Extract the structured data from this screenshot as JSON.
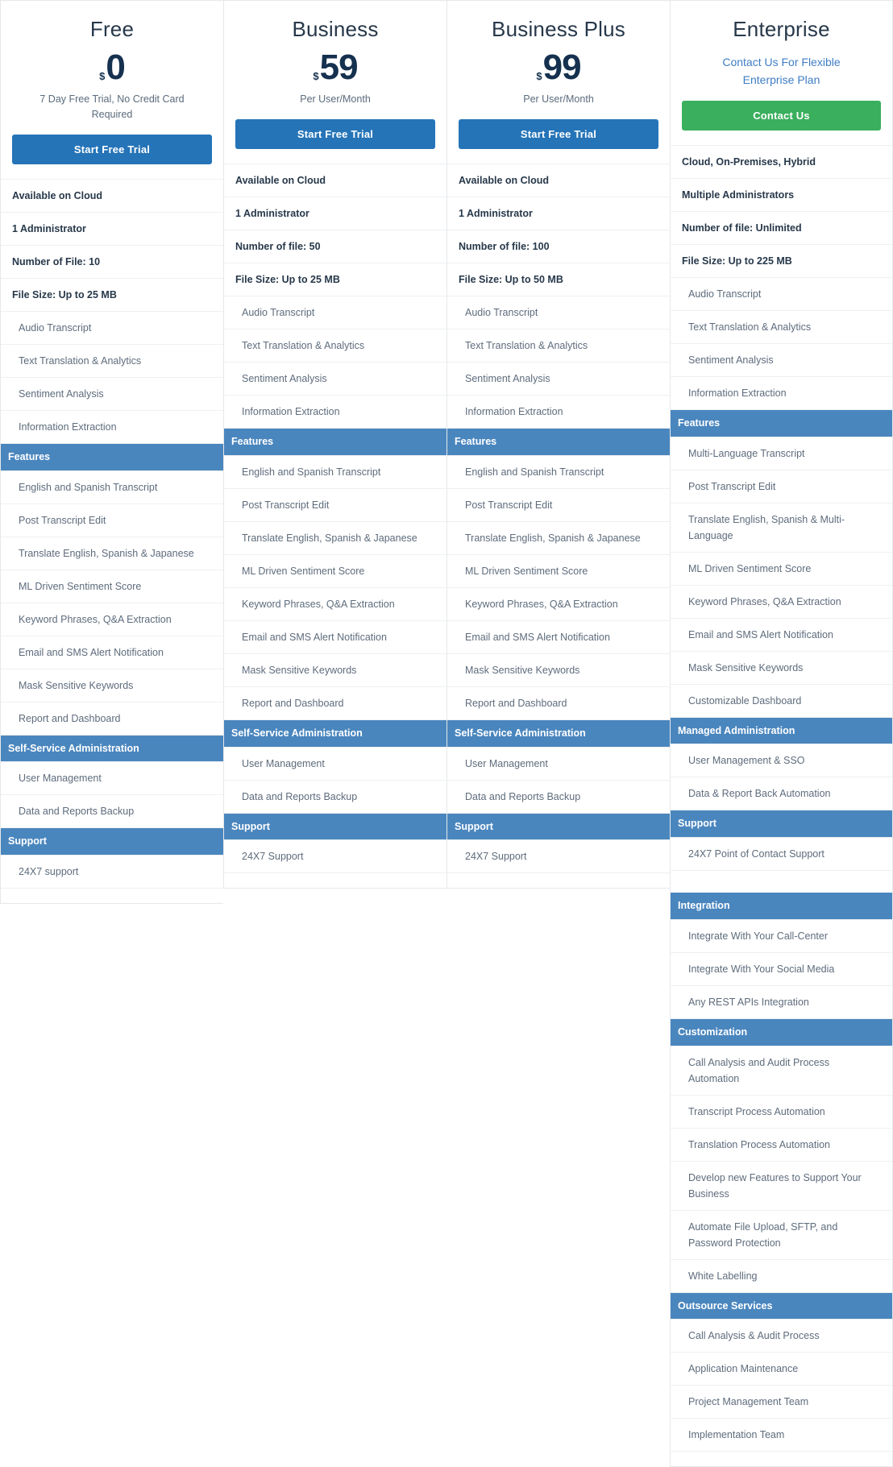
{
  "colors": {
    "accent_blue": "#2574b8",
    "section_header_blue": "#4a86be",
    "cta_green": "#3aaf5d",
    "price_navy": "#15314f",
    "link_blue": "#3f7dc4",
    "body_text": "#5e6c7c"
  },
  "plans": [
    {
      "name": "Free",
      "currency": "$",
      "amount": "0",
      "subtitle": "7 Day Free Trial, No Credit Card Required",
      "cta_label": "Start Free Trial",
      "cta_style": "blue",
      "specs": [
        "Available on Cloud",
        "1 Administrator",
        "Number of File: 10",
        "File Size: Up to 25 MB"
      ],
      "capabilities": [
        "Audio Transcript",
        "Text Translation & Analytics",
        "Sentiment Analysis",
        "Information Extraction"
      ],
      "sections": [
        {
          "title": "Features",
          "items": [
            "English and Spanish Transcript",
            "Post Transcript Edit",
            "Translate English, Spanish & Japanese",
            "ML Driven Sentiment Score",
            "Keyword Phrases, Q&A Extraction",
            "Email and SMS Alert Notification",
            "Mask Sensitive Keywords",
            "Report and Dashboard"
          ]
        },
        {
          "title": "Self-Service Administration",
          "items": [
            "User Management",
            "Data and Reports Backup"
          ]
        },
        {
          "title": "Support",
          "items": [
            "24X7 support"
          ]
        }
      ]
    },
    {
      "name": "Business",
      "currency": "$",
      "amount": "59",
      "subtitle": "Per User/Month",
      "cta_label": "Start Free Trial",
      "cta_style": "blue",
      "specs": [
        "Available on Cloud",
        "1 Administrator",
        "Number of file: 50",
        "File Size: Up to 25 MB"
      ],
      "capabilities": [
        "Audio Transcript",
        "Text Translation & Analytics",
        "Sentiment Analysis",
        "Information Extraction"
      ],
      "sections": [
        {
          "title": "Features",
          "items": [
            "English and Spanish Transcript",
            "Post Transcript Edit",
            "Translate English, Spanish & Japanese",
            "ML Driven Sentiment Score",
            "Keyword Phrases, Q&A Extraction",
            "Email and SMS Alert Notification",
            "Mask Sensitive Keywords",
            "Report and Dashboard"
          ]
        },
        {
          "title": "Self-Service Administration",
          "items": [
            "User Management",
            "Data and Reports Backup"
          ]
        },
        {
          "title": "Support",
          "items": [
            "24X7 Support"
          ]
        }
      ]
    },
    {
      "name": "Business Plus",
      "currency": "$",
      "amount": "99",
      "subtitle": "Per User/Month",
      "cta_label": "Start Free Trial",
      "cta_style": "blue",
      "specs": [
        "Available on Cloud",
        "1 Administrator",
        "Number of file: 100",
        "File Size: Up to 50 MB"
      ],
      "capabilities": [
        "Audio Transcript",
        "Text Translation & Analytics",
        "Sentiment Analysis",
        "Information Extraction"
      ],
      "sections": [
        {
          "title": "Features",
          "items": [
            "English and Spanish Transcript",
            "Post Transcript Edit",
            "Translate English, Spanish & Japanese",
            "ML Driven Sentiment Score",
            "Keyword Phrases, Q&A Extraction",
            "Email and SMS Alert Notification",
            "Mask Sensitive Keywords",
            "Report and Dashboard"
          ]
        },
        {
          "title": "Self-Service Administration",
          "items": [
            "User Management",
            "Data and Reports Backup"
          ]
        },
        {
          "title": "Support",
          "items": [
            "24X7 Support"
          ]
        }
      ]
    },
    {
      "name": "Enterprise",
      "contact_note": "Contact Us For Flexible Enterprise Plan",
      "cta_label": "Contact Us",
      "cta_style": "green",
      "specs": [
        "Cloud, On-Premises, Hybrid",
        "Multiple Administrators",
        "Number of file: Unlimited",
        "File Size: Up to 225 MB"
      ],
      "capabilities": [
        "Audio Transcript",
        "Text Translation & Analytics",
        "Sentiment Analysis",
        "Information Extraction"
      ],
      "sections": [
        {
          "title": "Features",
          "items": [
            "Multi-Language Transcript",
            "Post Transcript Edit",
            "Translate English, Spanish & Multi-Language",
            "ML Driven Sentiment Score",
            "Keyword Phrases, Q&A Extraction",
            "Email and SMS Alert Notification",
            "Mask Sensitive Keywords",
            "Customizable Dashboard"
          ]
        },
        {
          "title": "Managed Administration",
          "items": [
            "User Management & SSO",
            "Data & Report Back Automation"
          ]
        },
        {
          "title": "Support",
          "items": [
            "24X7 Point of Contact Support"
          ]
        },
        {
          "title": "Integration",
          "gap_before": true,
          "items": [
            "Integrate With Your Call-Center",
            "Integrate With Your Social Media",
            "Any REST APIs Integration"
          ]
        },
        {
          "title": "Customization",
          "items": [
            "Call Analysis and Audit Process Automation",
            "Transcript Process Automation",
            "Translation Process Automation",
            "Develop new Features to Support Your Business",
            "Automate File Upload, SFTP, and Password Protection",
            "White Labelling"
          ]
        },
        {
          "title": "Outsource Services",
          "items": [
            "Call Analysis & Audit Process",
            "Application Maintenance",
            "Project Management Team",
            "Implementation Team"
          ]
        }
      ]
    }
  ]
}
